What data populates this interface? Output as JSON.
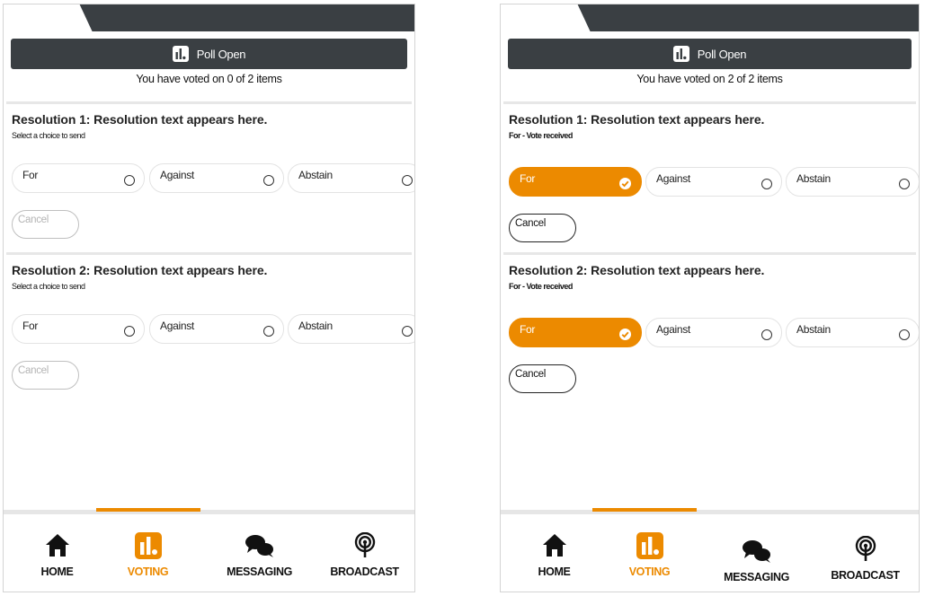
{
  "screens": [
    {
      "poll_title": "Poll Open",
      "vote_status": "You have voted on 0 of 2 items",
      "resolutions": [
        {
          "title": "Resolution 1: Resolution text appears here.",
          "subtitle": "Select a choice to send",
          "choices": [
            "For",
            "Against",
            "Abstain"
          ],
          "selected": "",
          "cancel_label": "Cancel"
        },
        {
          "title": "Resolution 2: Resolution text appears here.",
          "subtitle": "Select a choice to send",
          "choices": [
            "For",
            "Against",
            "Abstain"
          ],
          "selected": "",
          "cancel_label": "Cancel"
        }
      ],
      "nav": [
        {
          "label": "HOME",
          "icon": "home-icon"
        },
        {
          "label": "VOTING",
          "icon": "bar-chart-icon",
          "active": true
        },
        {
          "label": "MESSAGING",
          "icon": "chat-icon"
        },
        {
          "label": "BROADCAST",
          "icon": "broadcast-icon"
        }
      ]
    },
    {
      "poll_title": "Poll Open",
      "vote_status": "You have voted on 2 of 2 items",
      "resolutions": [
        {
          "title": "Resolution 1: Resolution text appears here.",
          "subtitle": "For - Vote received",
          "choices": [
            "For",
            "Against",
            "Abstain"
          ],
          "selected": "For",
          "cancel_label": "Cancel"
        },
        {
          "title": "Resolution 2: Resolution text appears here.",
          "subtitle": "For - Vote received",
          "choices": [
            "For",
            "Against",
            "Abstain"
          ],
          "selected": "For",
          "cancel_label": "Cancel"
        }
      ],
      "nav": [
        {
          "label": "HOME",
          "icon": "home-icon"
        },
        {
          "label": "VOTING",
          "icon": "bar-chart-icon",
          "active": true
        },
        {
          "label": "MESSAGING",
          "icon": "chat-icon"
        },
        {
          "label": "BROADCAST",
          "icon": "broadcast-icon"
        }
      ]
    }
  ],
  "colors": {
    "accent": "#ec8a00",
    "header_bar": "#3a3f43",
    "tab_strip": "#3a3f43",
    "separator": "#e6e6e6"
  }
}
